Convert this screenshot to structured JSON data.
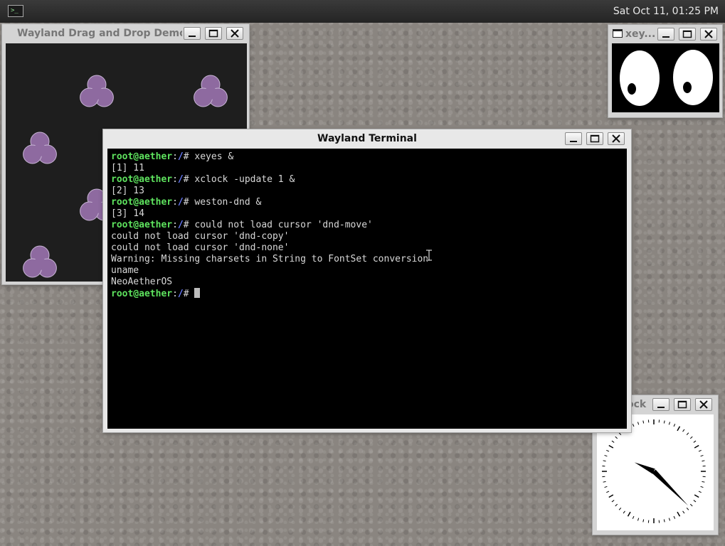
{
  "panel": {
    "clock": "Sat Oct 11, 01:25 PM",
    "launcher_glyph": ">_"
  },
  "dnd_window": {
    "title": "Wayland Drag and Drop Demo",
    "item_color": "#8e6aa0"
  },
  "xeyes_window": {
    "title": "xey..."
  },
  "xclock_window": {
    "title": "ock",
    "hour_hand_degrees": 295,
    "minute_hand_degrees": 135
  },
  "terminal": {
    "title": "Wayland Terminal",
    "prompt": {
      "user_host": "root@aether",
      "sep": ":",
      "path": "/",
      "symbol": "# "
    },
    "lines": [
      {
        "kind": "prompt",
        "text": "xeyes &"
      },
      {
        "kind": "out",
        "text": "[1] 11"
      },
      {
        "kind": "prompt",
        "text": "xclock -update 1 &"
      },
      {
        "kind": "out",
        "text": "[2] 13"
      },
      {
        "kind": "prompt",
        "text": "weston-dnd &"
      },
      {
        "kind": "out",
        "text": "[3] 14"
      },
      {
        "kind": "prompt",
        "text": "could not load cursor 'dnd-move'"
      },
      {
        "kind": "out",
        "text": "could not load cursor 'dnd-copy'"
      },
      {
        "kind": "out",
        "text": "could not load cursor 'dnd-none'"
      },
      {
        "kind": "out",
        "text": "Warning: Missing charsets in String to FontSet conversion"
      },
      {
        "kind": "out",
        "text": "uname"
      },
      {
        "kind": "out",
        "text": "NeoAetherOS"
      },
      {
        "kind": "prompt",
        "text": ""
      }
    ]
  },
  "colors": {
    "prompt_user": "#5ee35e",
    "prompt_path": "#6a7dff",
    "terminal_bg": "#000000"
  }
}
